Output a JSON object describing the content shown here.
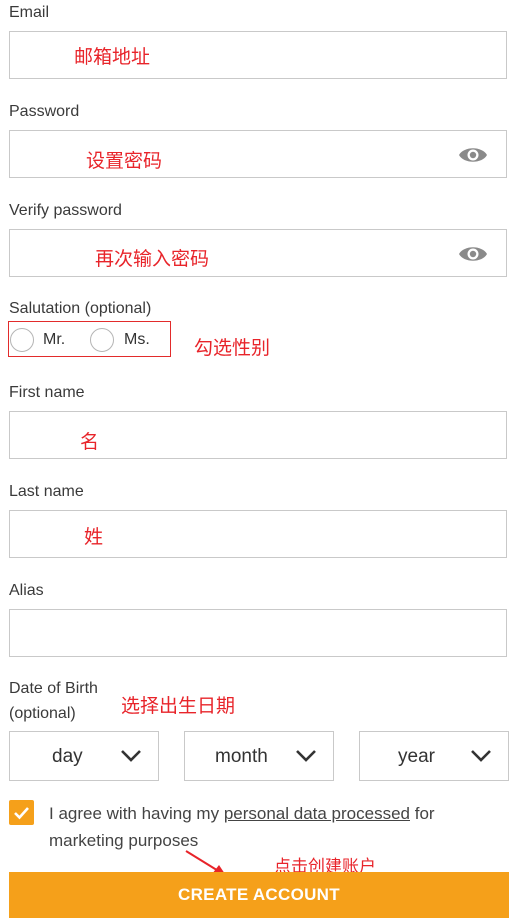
{
  "email": {
    "label": "Email",
    "annotation": "邮箱地址"
  },
  "password": {
    "label": "Password",
    "annotation": "设置密码",
    "toggle_icon": "eye-icon"
  },
  "verify_password": {
    "label": "Verify password",
    "annotation": "再次输入密码",
    "toggle_icon": "eye-icon"
  },
  "salutation": {
    "label": "Salutation (optional)",
    "options": [
      "Mr.",
      "Ms."
    ],
    "annotation": "勾选性别"
  },
  "first_name": {
    "label": "First name",
    "annotation": "名"
  },
  "last_name": {
    "label": "Last name",
    "annotation": "姓"
  },
  "alias": {
    "label": "Alias"
  },
  "dob": {
    "label_line1": "Date of Birth",
    "label_line2": "(optional)",
    "annotation": "选择出生日期",
    "day": "day",
    "month": "month",
    "year": "year"
  },
  "consent": {
    "checked": true,
    "text_before": "I agree with having my ",
    "link": "personal data processed",
    "text_after": " for marketing purposes"
  },
  "submit": {
    "label": "CREATE ACCOUNT",
    "annotation": "点击创建账户"
  },
  "colors": {
    "accent": "#f5a01a",
    "annotation": "#e8242a",
    "border": "#c9c9c9"
  }
}
